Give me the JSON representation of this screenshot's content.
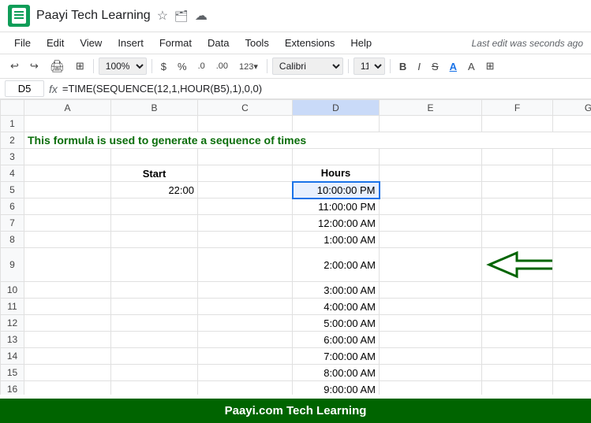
{
  "titleBar": {
    "appName": "Paayi Tech Learning",
    "starIcon": "☆",
    "folderIcon": "⊡",
    "cloudIcon": "☁"
  },
  "menuBar": {
    "items": [
      "File",
      "Edit",
      "View",
      "Insert",
      "Format",
      "Data",
      "Tools",
      "Extensions",
      "Help"
    ],
    "lastEdit": "Last edit was seconds ago"
  },
  "toolbar": {
    "undoIcon": "↩",
    "redoIcon": "↪",
    "printIcon": "🖨",
    "paintIcon": "⊞",
    "zoom": "100%",
    "dollarSign": "$",
    "percentSign": "%",
    "decimal0": ".0",
    "decimal00": ".00",
    "number123": "123▾",
    "font": "Calibri",
    "fontSize": "11",
    "boldLabel": "B",
    "italicLabel": "I",
    "strikeLabel": "S̶",
    "underlineLabel": "A",
    "paintBucket": "A",
    "borderIcon": "⊞"
  },
  "formulaBar": {
    "cellRef": "D5",
    "fxLabel": "fx",
    "formula": "=TIME(SEQUENCE(12,1,HOUR(B5),1),0,0)"
  },
  "columns": {
    "headers": [
      "",
      "A",
      "B",
      "C",
      "D",
      "E",
      "F",
      "G"
    ]
  },
  "rows": [
    {
      "num": "1",
      "cells": [
        "",
        "",
        "",
        "",
        "",
        "",
        "",
        ""
      ]
    },
    {
      "num": "2",
      "cells": [
        "",
        "This formula is used to generate a sequence of times",
        "",
        "",
        "",
        "",
        "",
        ""
      ]
    },
    {
      "num": "3",
      "cells": [
        "",
        "",
        "",
        "",
        "",
        "",
        "",
        ""
      ]
    },
    {
      "num": "4",
      "cells": [
        "",
        "",
        "Start",
        "",
        "Hours",
        "",
        "",
        ""
      ]
    },
    {
      "num": "5",
      "cells": [
        "",
        "",
        "22:00",
        "",
        "10:00:00 PM",
        "",
        "",
        ""
      ],
      "selectedCol": 3
    },
    {
      "num": "6",
      "cells": [
        "",
        "",
        "",
        "",
        "11:00:00 PM",
        "",
        "",
        ""
      ]
    },
    {
      "num": "7",
      "cells": [
        "",
        "",
        "",
        "",
        "12:00:00 AM",
        "",
        "",
        ""
      ]
    },
    {
      "num": "8",
      "cells": [
        "",
        "",
        "",
        "",
        "1:00:00 AM",
        "",
        "",
        ""
      ]
    },
    {
      "num": "9",
      "cells": [
        "",
        "",
        "",
        "",
        "2:00:00 AM",
        "",
        "←arrow",
        ""
      ]
    },
    {
      "num": "10",
      "cells": [
        "",
        "",
        "",
        "",
        "3:00:00 AM",
        "",
        "",
        ""
      ]
    },
    {
      "num": "11",
      "cells": [
        "",
        "",
        "",
        "",
        "4:00:00 AM",
        "",
        "",
        ""
      ]
    },
    {
      "num": "12",
      "cells": [
        "",
        "",
        "",
        "",
        "5:00:00 AM",
        "",
        "",
        ""
      ]
    },
    {
      "num": "13",
      "cells": [
        "",
        "",
        "",
        "",
        "6:00:00 AM",
        "",
        "",
        ""
      ]
    },
    {
      "num": "14",
      "cells": [
        "",
        "",
        "",
        "",
        "7:00:00 AM",
        "",
        "",
        ""
      ]
    },
    {
      "num": "15",
      "cells": [
        "",
        "",
        "",
        "",
        "8:00:00 AM",
        "",
        "",
        ""
      ]
    },
    {
      "num": "16",
      "cells": [
        "",
        "",
        "",
        "",
        "9:00:00 AM",
        "",
        "",
        ""
      ]
    }
  ],
  "bottomBar": {
    "text": "Paayi.com Tech Learning"
  }
}
